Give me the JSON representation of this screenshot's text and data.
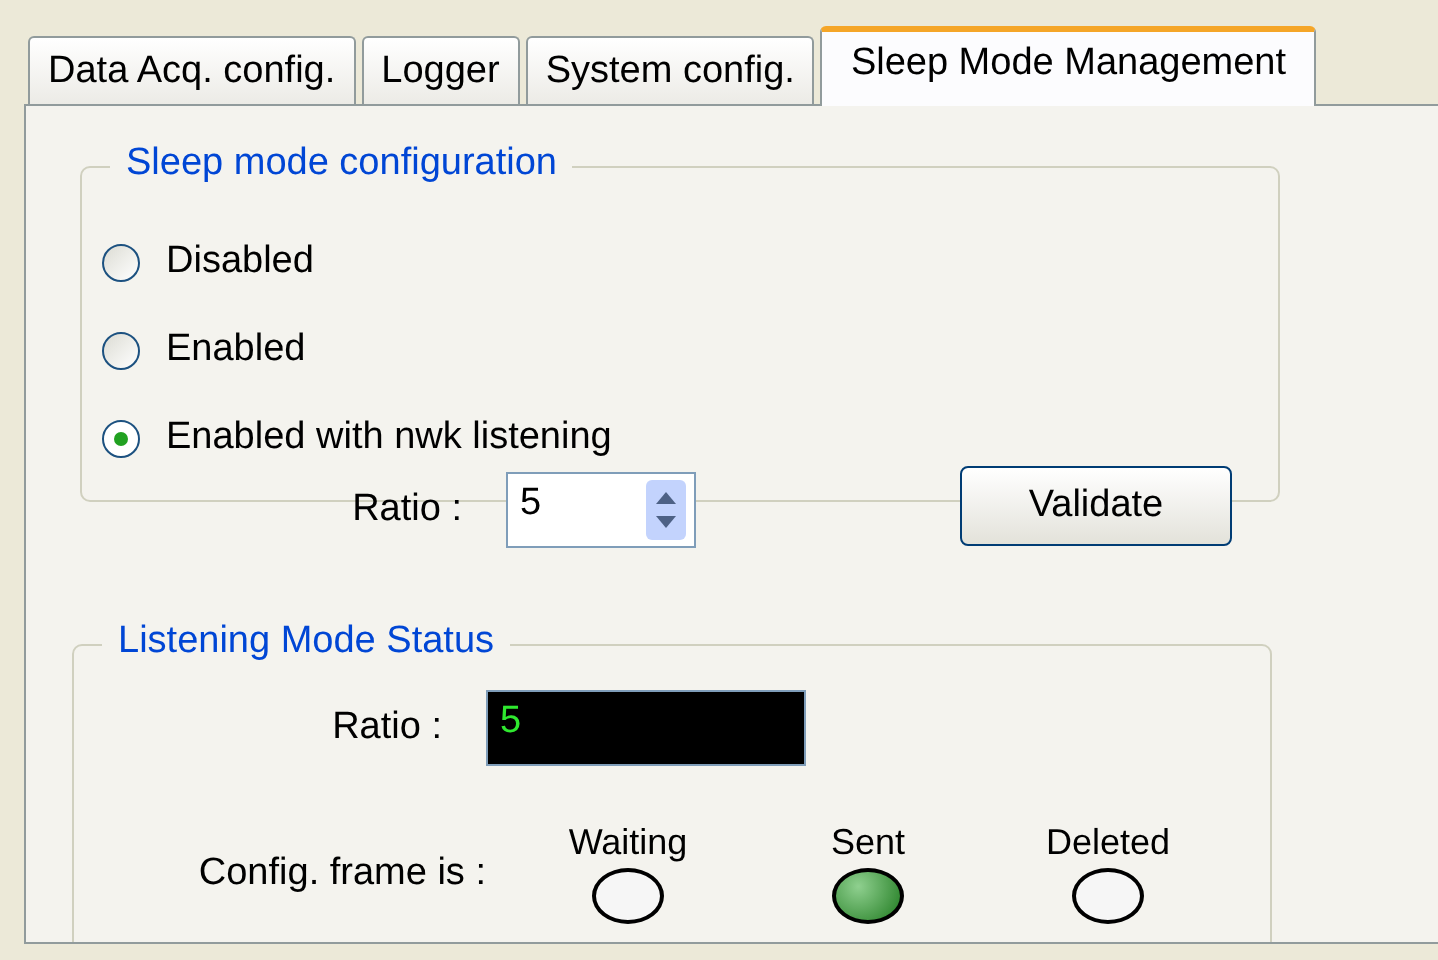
{
  "tabs": [
    {
      "label": "Data Acq. config.",
      "selected": false
    },
    {
      "label": "Logger",
      "selected": false
    },
    {
      "label": "System config.",
      "selected": false
    },
    {
      "label": "Sleep Mode Management",
      "selected": true
    }
  ],
  "sleep_mode_configuration": {
    "title": "Sleep mode configuration",
    "options": [
      {
        "label": "Disabled",
        "selected": false
      },
      {
        "label": "Enabled",
        "selected": false
      },
      {
        "label": "Enabled with nwk listening",
        "selected": true
      }
    ],
    "ratio_label": "Ratio :",
    "ratio_value": "5",
    "validate_button": "Validate"
  },
  "listening_mode_status": {
    "title": "Listening Mode Status",
    "ratio_label": "Ratio :",
    "ratio_value": "5",
    "frame_label": "Config. frame is :",
    "indicators": [
      {
        "label": "Waiting",
        "on": false
      },
      {
        "label": "Sent",
        "on": true
      },
      {
        "label": "Deleted",
        "on": false
      }
    ]
  }
}
